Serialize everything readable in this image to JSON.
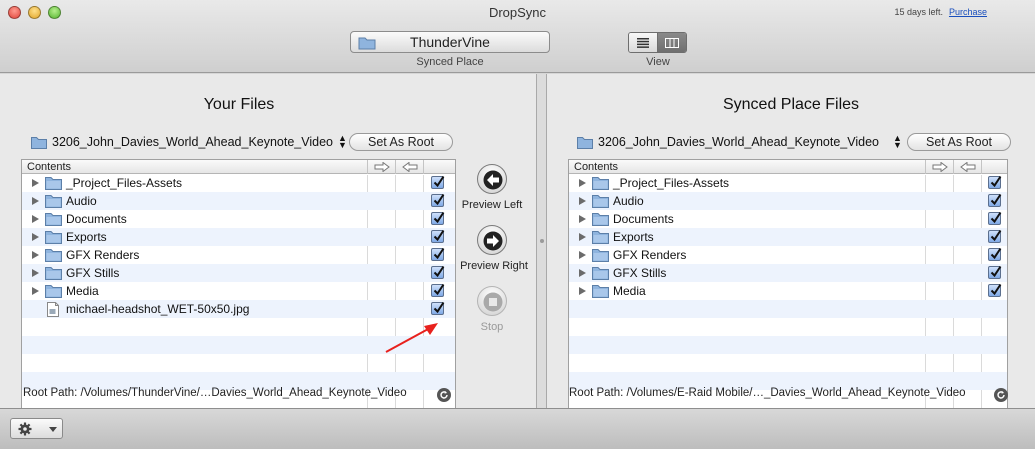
{
  "window": {
    "title": "DropSync",
    "trial_text": "15 days left.",
    "purchase_label": "Purchase"
  },
  "toolbar": {
    "synced_place_value": "ThunderVine",
    "synced_place_label": "Synced Place",
    "view_label": "View"
  },
  "left": {
    "title": "Your Files",
    "path": "3206_John_Davies_World_Ahead_Keynote_Video",
    "set_root_label": "Set As Root",
    "contents_header": "Contents",
    "root_path_label": "Root Path:",
    "root_path_value": "/Volumes/ThunderVine/…Davies_World_Ahead_Keynote_Video",
    "items": [
      {
        "name": "_Project_Files-Assets",
        "type": "folder",
        "checked": true
      },
      {
        "name": "Audio",
        "type": "folder",
        "checked": true
      },
      {
        "name": "Documents",
        "type": "folder",
        "checked": true
      },
      {
        "name": "Exports",
        "type": "folder",
        "checked": true
      },
      {
        "name": "GFX Renders",
        "type": "folder",
        "checked": true
      },
      {
        "name": "GFX Stills",
        "type": "folder",
        "checked": true
      },
      {
        "name": "Media",
        "type": "folder",
        "checked": true
      },
      {
        "name": "michael-headshot_WET-50x50.jpg",
        "type": "file",
        "checked": true
      }
    ]
  },
  "middle": {
    "preview_left_label": "Preview Left",
    "preview_right_label": "Preview Right",
    "stop_label": "Stop"
  },
  "right": {
    "title": "Synced Place Files",
    "path": "3206_John_Davies_World_Ahead_Keynote_Video",
    "set_root_label": "Set As Root",
    "contents_header": "Contents",
    "root_path_label": "Root Path:",
    "root_path_value": "/Volumes/E-Raid Mobile/…_Davies_World_Ahead_Keynote_Video",
    "items": [
      {
        "name": "_Project_Files-Assets",
        "type": "folder",
        "checked": true
      },
      {
        "name": "Audio",
        "type": "folder",
        "checked": true
      },
      {
        "name": "Documents",
        "type": "folder",
        "checked": true
      },
      {
        "name": "Exports",
        "type": "folder",
        "checked": true
      },
      {
        "name": "GFX Renders",
        "type": "folder",
        "checked": true
      },
      {
        "name": "GFX Stills",
        "type": "folder",
        "checked": true
      },
      {
        "name": "Media",
        "type": "folder",
        "checked": true
      }
    ]
  },
  "colors": {
    "annotation_arrow": "#e8211d",
    "checkbox_blue": "#7fa9e6",
    "folder_blue": "#8fb4de"
  },
  "icons": {
    "gear": "gear-icon",
    "folder": "folder-icon",
    "file": "file-icon",
    "refresh": "refresh-icon"
  }
}
